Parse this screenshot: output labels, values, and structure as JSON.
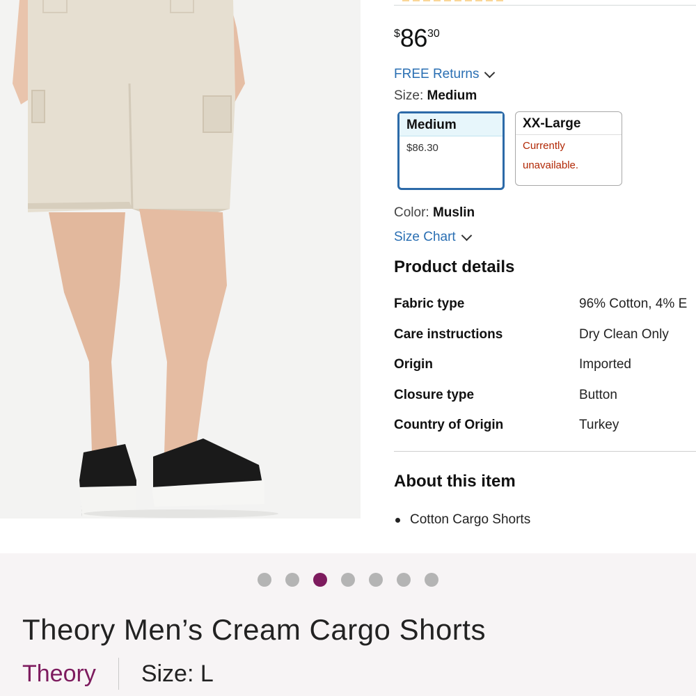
{
  "product_page": {
    "price": {
      "symbol": "$",
      "whole": "86",
      "fraction": "30"
    },
    "free_returns": "FREE Returns",
    "size_label": "Size:",
    "size_value": "Medium",
    "size_options": [
      {
        "name": "Medium",
        "detail": "$86.30",
        "selected": true
      },
      {
        "name": "XX-Large",
        "detail_line1": "Currently",
        "detail_line2": "unavailable.",
        "selected": false
      }
    ],
    "color_label": "Color:",
    "color_value": "Muslin",
    "size_chart": "Size Chart",
    "product_details_title": "Product details",
    "product_details": [
      {
        "key": "Fabric type",
        "value": "96% Cotton, 4% E"
      },
      {
        "key": "Care instructions",
        "value": "Dry Clean Only"
      },
      {
        "key": "Origin",
        "value": "Imported"
      },
      {
        "key": "Closure type",
        "value": "Button"
      },
      {
        "key": "Country of Origin",
        "value": "Turkey"
      }
    ],
    "about_title": "About this item",
    "about_bullets": [
      "Cotton Cargo Shorts"
    ]
  },
  "carousel": {
    "total": 7,
    "active_index": 2
  },
  "listing": {
    "title": "Theory Men’s Cream Cargo Shorts",
    "brand": "Theory",
    "size": "Size: L"
  },
  "colors": {
    "accent": "#7d1b5e",
    "link": "#2a6fb3",
    "unavailable": "#b12704",
    "selected_border": "#2c6aa8"
  }
}
